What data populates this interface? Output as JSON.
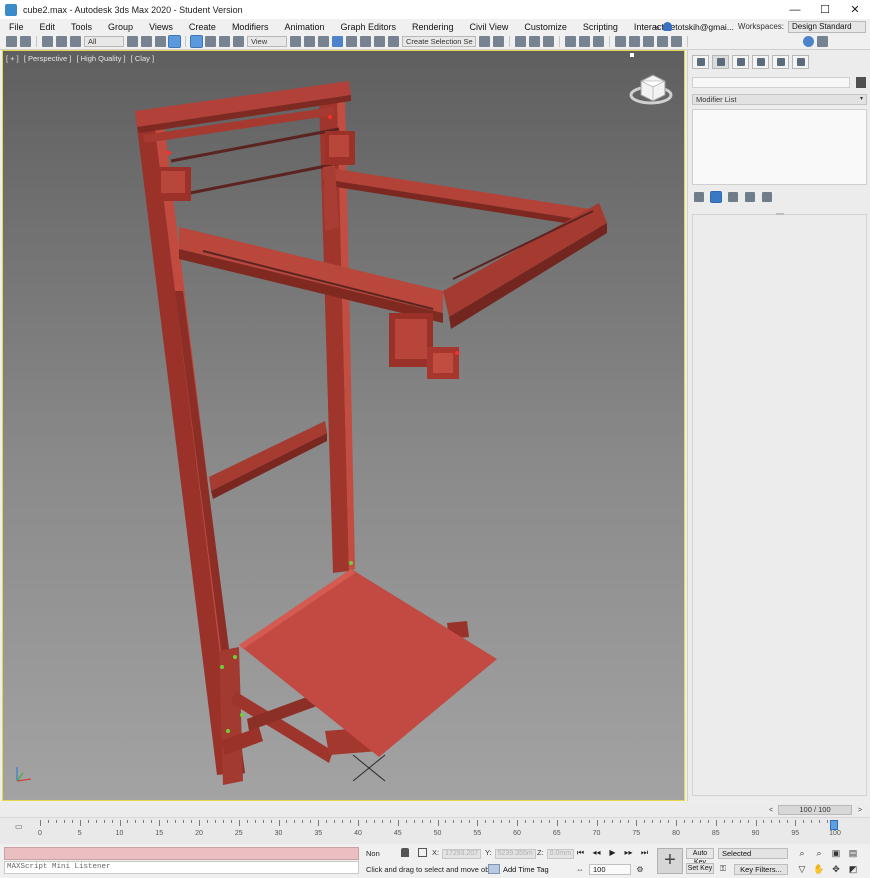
{
  "window": {
    "title": "cube2.max - Autodesk 3ds Max 2020 - Student Version",
    "minimize": "—",
    "maximize": "☐",
    "close": "✕"
  },
  "menu": {
    "items": [
      "File",
      "Edit",
      "Tools",
      "Group",
      "Views",
      "Create",
      "Modifiers",
      "Animation",
      "Graph Editors",
      "Rendering",
      "Civil View",
      "Customize",
      "Scripting",
      "Interactive"
    ],
    "more": "»",
    "user": "totskih@gmai...",
    "workspaces_label": "Workspaces:",
    "workspace": "Design Standard"
  },
  "toolbar": {
    "selection_filter": "All",
    "ref_coord": "View",
    "named_selection": "Create Selection Se"
  },
  "viewport": {
    "label_plus": "[ + ]",
    "label_view": "[ Perspective ]",
    "label_quality": "[ High Quality ]",
    "label_shading": "[ Clay ]",
    "model_color": "#a8372e",
    "bed_color": "#c24a42"
  },
  "command_panel": {
    "modifier_list": "Modifier List",
    "dropdown_arrow": "▾"
  },
  "time_slider": {
    "frame_display": "100 / 100",
    "prev": "<",
    "next": ">"
  },
  "trackbar": {
    "ticks": [
      "0",
      "5",
      "10",
      "15",
      "20",
      "25",
      "30",
      "35",
      "40",
      "45",
      "50",
      "55",
      "60",
      "65",
      "70",
      "75",
      "80",
      "85",
      "90",
      "95",
      "100"
    ]
  },
  "status": {
    "selection": "Non",
    "x_label": "X:",
    "x_value": "17293.207",
    "y_label": "Y:",
    "y_value": "5239.355m",
    "z_label": "Z:",
    "z_value": "0.0mm",
    "prompt": "Click and drag to select and move objec",
    "add_time_tag": "Add Time Tag",
    "maxscript": "MAXScript Mini Listener",
    "current_frame": "100",
    "auto_key": "Auto Key",
    "set_key": "Set Key",
    "key_mode": "Selected",
    "key_filters": "Key Filters..."
  }
}
